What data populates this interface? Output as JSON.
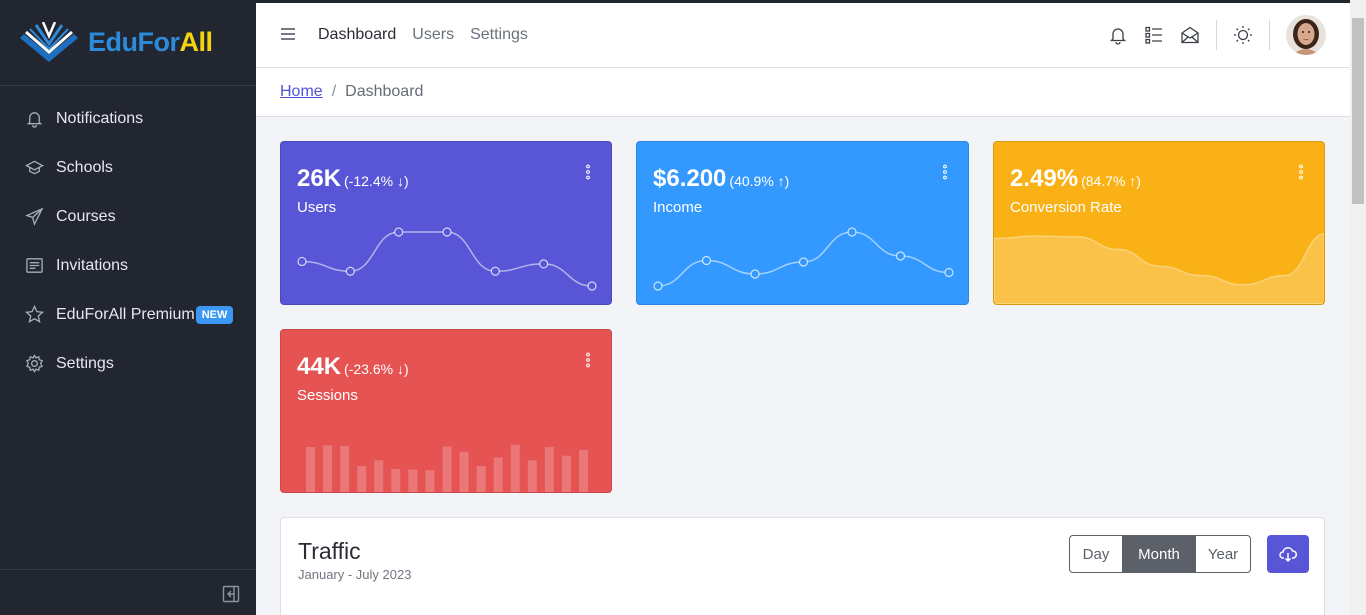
{
  "brand": {
    "part1": "EduFor",
    "part2": "All"
  },
  "sidebar": {
    "items": [
      {
        "label": "Notifications",
        "icon": "bell-icon"
      },
      {
        "label": "Schools",
        "icon": "school-icon"
      },
      {
        "label": "Courses",
        "icon": "send-icon"
      },
      {
        "label": "Invitations",
        "icon": "invitation-icon"
      },
      {
        "label": "EduForAll Premium",
        "icon": "star-icon",
        "badge": "NEW"
      },
      {
        "label": "Settings",
        "icon": "gear-icon"
      }
    ]
  },
  "header": {
    "links": [
      "Dashboard",
      "Users",
      "Settings"
    ],
    "active_link": "Dashboard"
  },
  "breadcrumb": {
    "home": "Home",
    "separator": "/",
    "current": "Dashboard"
  },
  "widgets": [
    {
      "value": "26K",
      "change": "(-12.4% ↓)",
      "label": "Users",
      "color": "#5856d6",
      "chart": "line",
      "points": [
        58,
        54,
        70,
        70,
        54,
        57,
        48
      ]
    },
    {
      "value": "$6.200",
      "change": "(40.9% ↑)",
      "label": "Income",
      "color": "#3399ff",
      "chart": "line",
      "points": [
        1,
        18,
        9,
        17,
        37,
        21,
        10
      ]
    },
    {
      "value": "2.49%",
      "change": "(84.7% ↑)",
      "label": "Conversion Rate",
      "color": "#f9b115",
      "chart": "area",
      "points": [
        78,
        81,
        80,
        65,
        45,
        34,
        23,
        34,
        84
      ]
    },
    {
      "value": "44K",
      "change": "(-23.6% ↓)",
      "label": "Sessions",
      "color": "#e55353",
      "chart": "bar",
      "points": [
        78,
        81,
        80,
        45,
        55,
        40,
        39,
        38,
        79,
        70,
        45,
        60,
        82,
        55,
        78,
        63,
        73
      ]
    }
  ],
  "traffic": {
    "title": "Traffic",
    "subtitle": "January - July 2023",
    "ranges": [
      "Day",
      "Month",
      "Year"
    ],
    "active_range": "Month"
  },
  "colors": {
    "sidebar_bg": "#212631",
    "accent": "#5856d6"
  }
}
